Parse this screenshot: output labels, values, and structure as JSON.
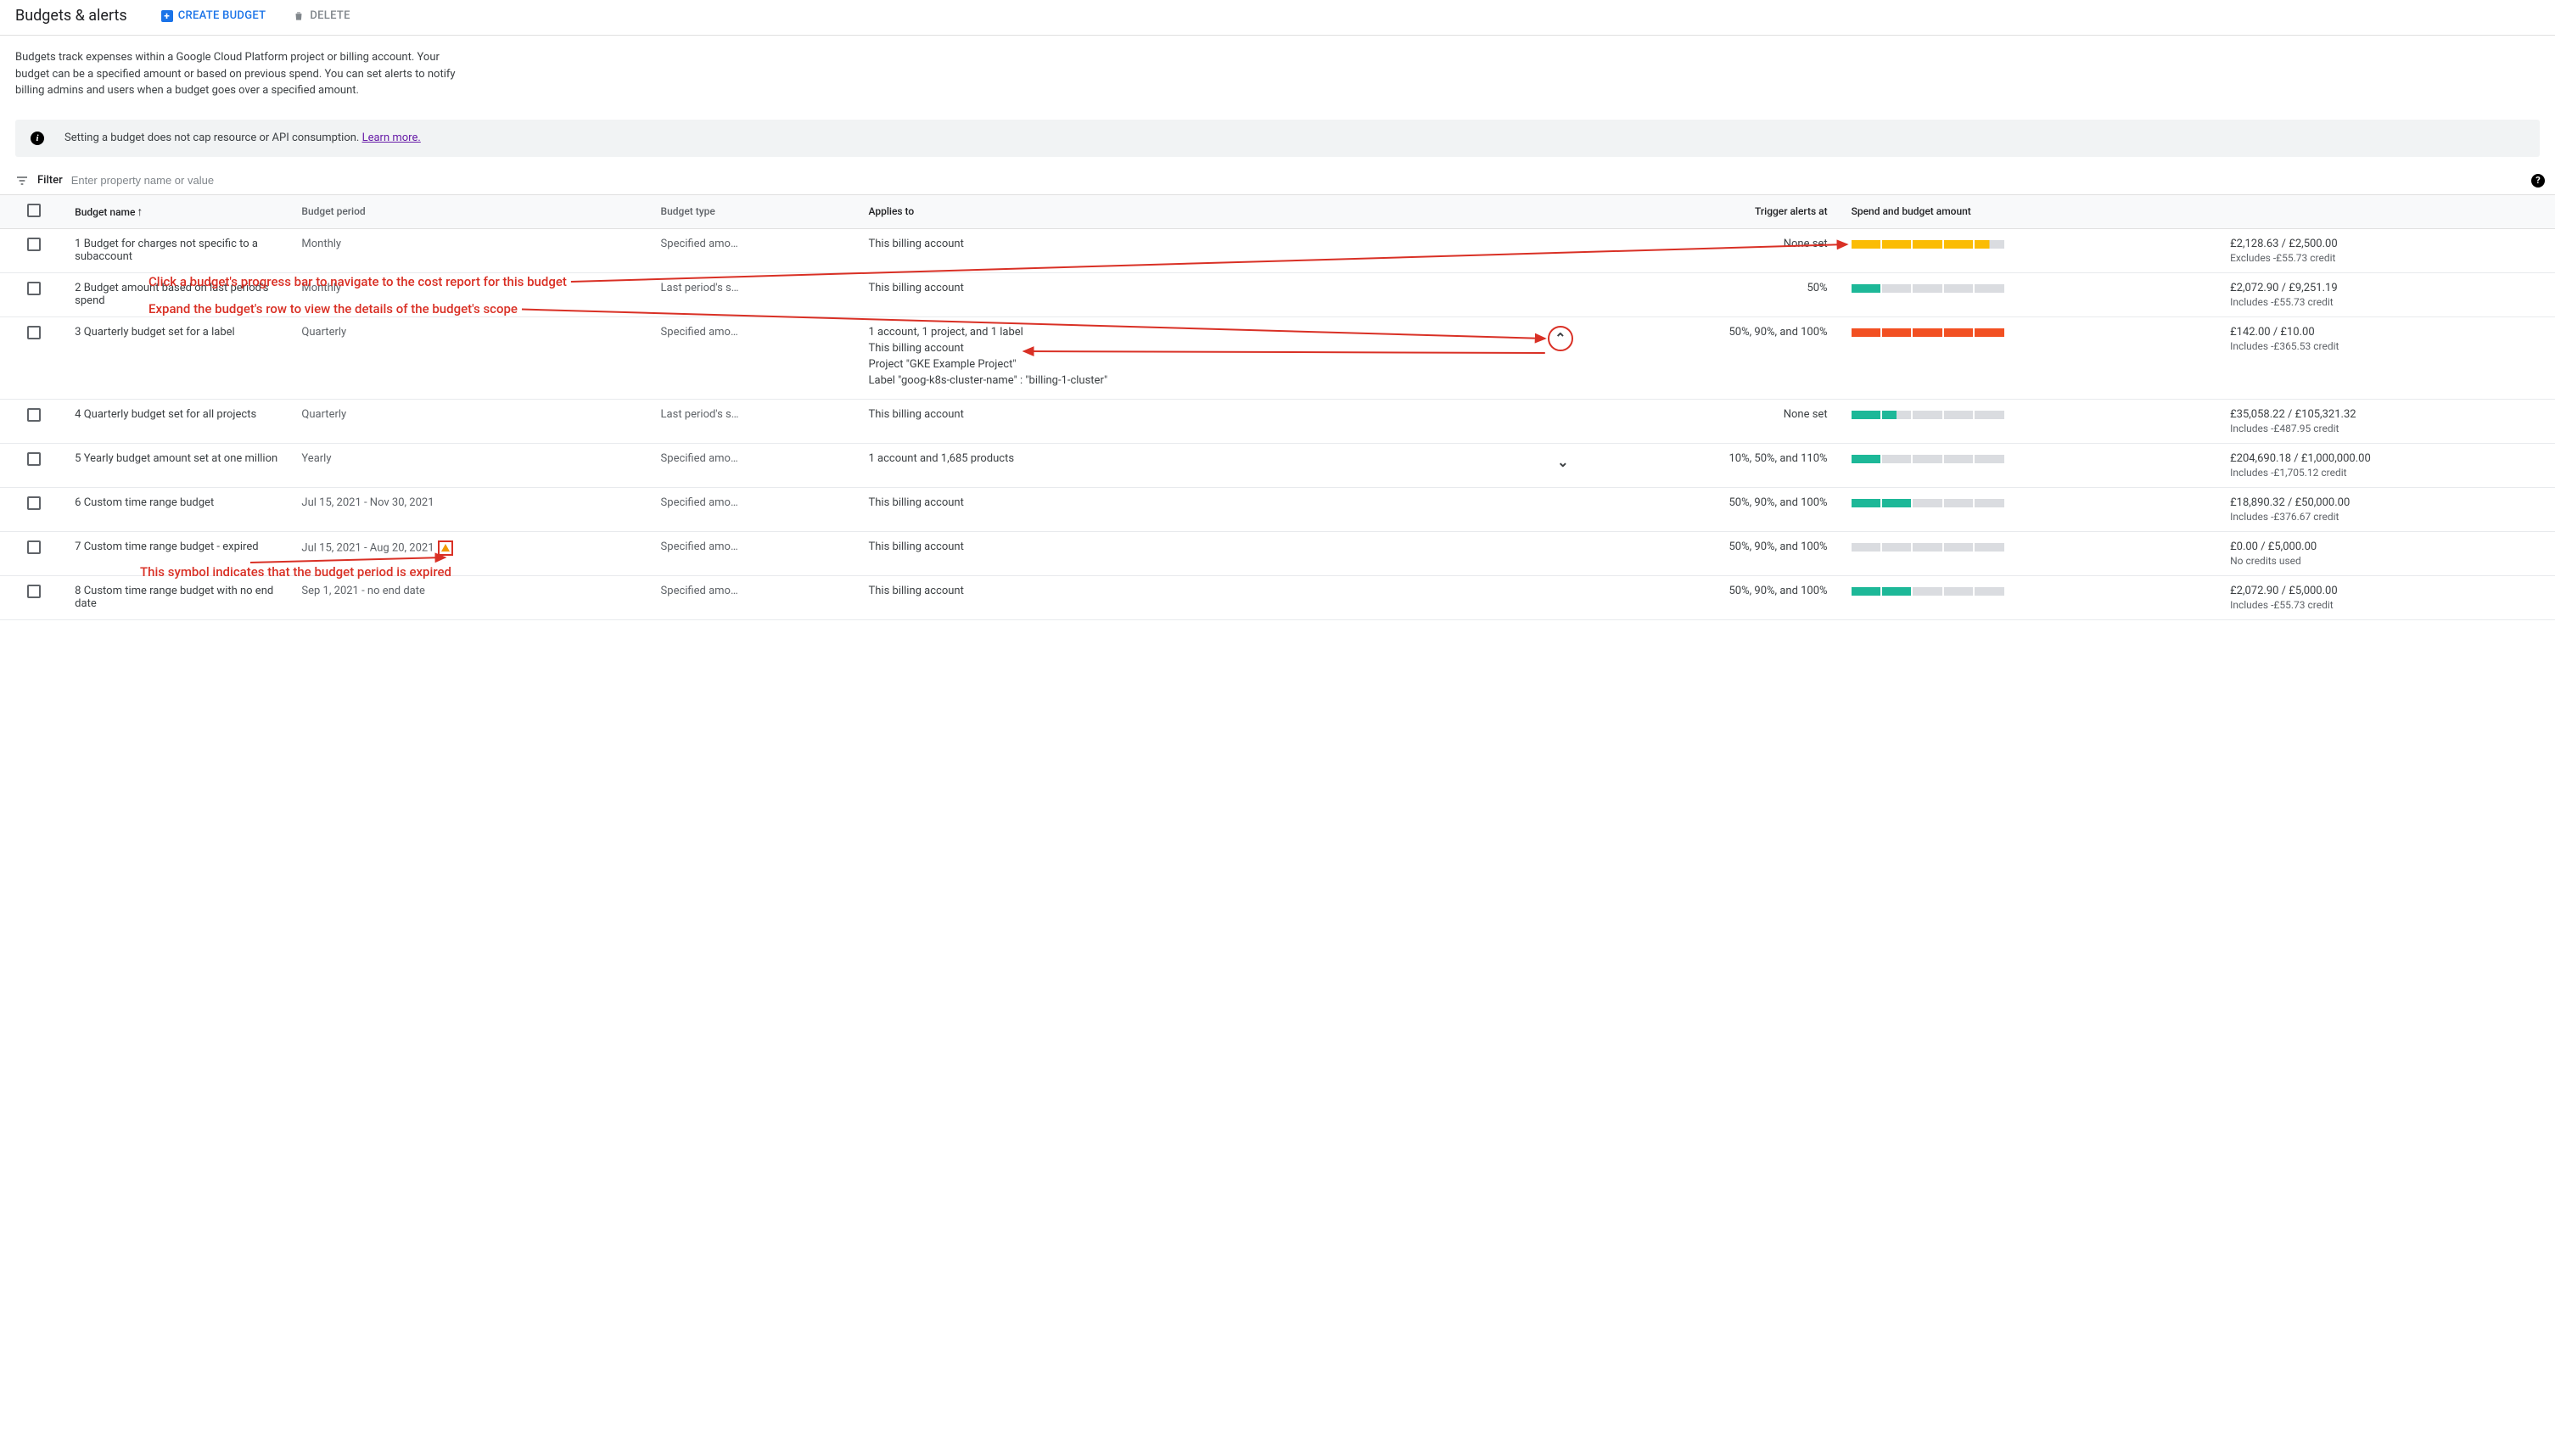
{
  "header": {
    "title": "Budgets & alerts",
    "create_label": "CREATE BUDGET",
    "delete_label": "DELETE"
  },
  "intro_text": "Budgets track expenses within a Google Cloud Platform project or billing account. Your budget can be a specified amount or based on previous spend. You can set alerts to notify billing admins and users when a budget goes over a specified amount.",
  "info_banner": {
    "text": "Setting a budget does not cap resource or API consumption. ",
    "link_text": "Learn more."
  },
  "filter": {
    "label": "Filter",
    "placeholder": "Enter property name or value"
  },
  "columns": {
    "name": "Budget name",
    "period": "Budget period",
    "type": "Budget type",
    "applies": "Applies to",
    "trigger": "Trigger alerts at",
    "spend": "Spend and budget amount"
  },
  "rows": [
    {
      "name": "1 Budget for charges not specific to a subaccount",
      "period": "Monthly",
      "type": "Specified amo…",
      "applies_lines": [
        "This billing account"
      ],
      "expand": "none",
      "trigger": "None set",
      "progress": {
        "color": "yellow",
        "filled": 4,
        "total": 5,
        "last_partial": true
      },
      "amount": "£2,128.63 / £2,500.00",
      "credit": "Excludes -£55.73 credit"
    },
    {
      "name": "2 Budget amount based on last period's spend",
      "period": "Monthly",
      "type": "Last period's s…",
      "applies_lines": [
        "This billing account"
      ],
      "expand": "none",
      "trigger": "50%",
      "progress": {
        "color": "teal",
        "filled": 1,
        "total": 5,
        "last_partial": false
      },
      "amount": "£2,072.90 / £9,251.19",
      "credit": "Includes -£55.73 credit"
    },
    {
      "name": "3 Quarterly budget set for a label",
      "period": "Quarterly",
      "type": "Specified amo…",
      "applies_lines": [
        "1 account, 1 project, and 1 label",
        "This billing account",
        "Project \"GKE Example Project\"",
        "Label \"goog-k8s-cluster-name\" : \"billing-1-cluster\""
      ],
      "expand": "up-circled",
      "trigger": "50%, 90%, and 100%",
      "progress": {
        "color": "orange",
        "filled": 5,
        "total": 5,
        "last_partial": false
      },
      "amount": "£142.00 / £10.00",
      "credit": "Includes -£365.53 credit"
    },
    {
      "name": "4 Quarterly budget set for all projects",
      "period": "Quarterly",
      "type": "Last period's s…",
      "applies_lines": [
        "This billing account"
      ],
      "expand": "none",
      "trigger": "None set",
      "progress": {
        "color": "teal",
        "filled": 1,
        "total": 5,
        "last_partial": true
      },
      "amount": "£35,058.22 / £105,321.32",
      "credit": "Includes -£487.95 credit"
    },
    {
      "name": "5 Yearly budget amount set at one million",
      "period": "Yearly",
      "type": "Specified amo…",
      "applies_lines": [
        "1 account and 1,685 products"
      ],
      "expand": "down",
      "trigger": "10%, 50%, and 110%",
      "progress": {
        "color": "teal",
        "filled": 1,
        "total": 5,
        "last_partial": false
      },
      "amount": "£204,690.18 / £1,000,000.00",
      "credit": "Includes -£1,705.12 credit"
    },
    {
      "name": "6 Custom time range budget",
      "period": "Jul 15, 2021 - Nov 30, 2021",
      "type": "Specified amo…",
      "applies_lines": [
        "This billing account"
      ],
      "expand": "none",
      "trigger": "50%, 90%, and 100%",
      "progress": {
        "color": "teal",
        "filled": 2,
        "total": 5,
        "last_partial": false
      },
      "amount": "£18,890.32 / £50,000.00",
      "credit": "Includes -£376.67 credit"
    },
    {
      "name": "7 Custom time range budget - expired",
      "period": "Jul 15, 2021 - Aug 20, 2021",
      "period_warn": true,
      "type": "Specified amo…",
      "applies_lines": [
        "This billing account"
      ],
      "expand": "none",
      "trigger": "50%, 90%, and 100%",
      "progress": {
        "color": "none",
        "filled": 0,
        "total": 5,
        "last_partial": false
      },
      "amount": "£0.00 / £5,000.00",
      "credit": "No credits used"
    },
    {
      "name": "8 Custom time range budget with no end date",
      "period": "Sep 1, 2021 - no end date",
      "type": "Specified amo…",
      "applies_lines": [
        "This billing account"
      ],
      "expand": "none",
      "trigger": "50%, 90%, and 100%",
      "progress": {
        "color": "teal",
        "filled": 2,
        "total": 5,
        "last_partial": false
      },
      "amount": "£2,072.90 / £5,000.00",
      "credit": "Includes -£55.73 credit"
    }
  ],
  "annotations": {
    "progress_tip": "Click a budget's progress bar to navigate to the cost report for this budget",
    "expand_tip": "Expand the budget's row to view the details of the budget's scope",
    "expired_tip": "This symbol indicates that the budget period is expired"
  }
}
